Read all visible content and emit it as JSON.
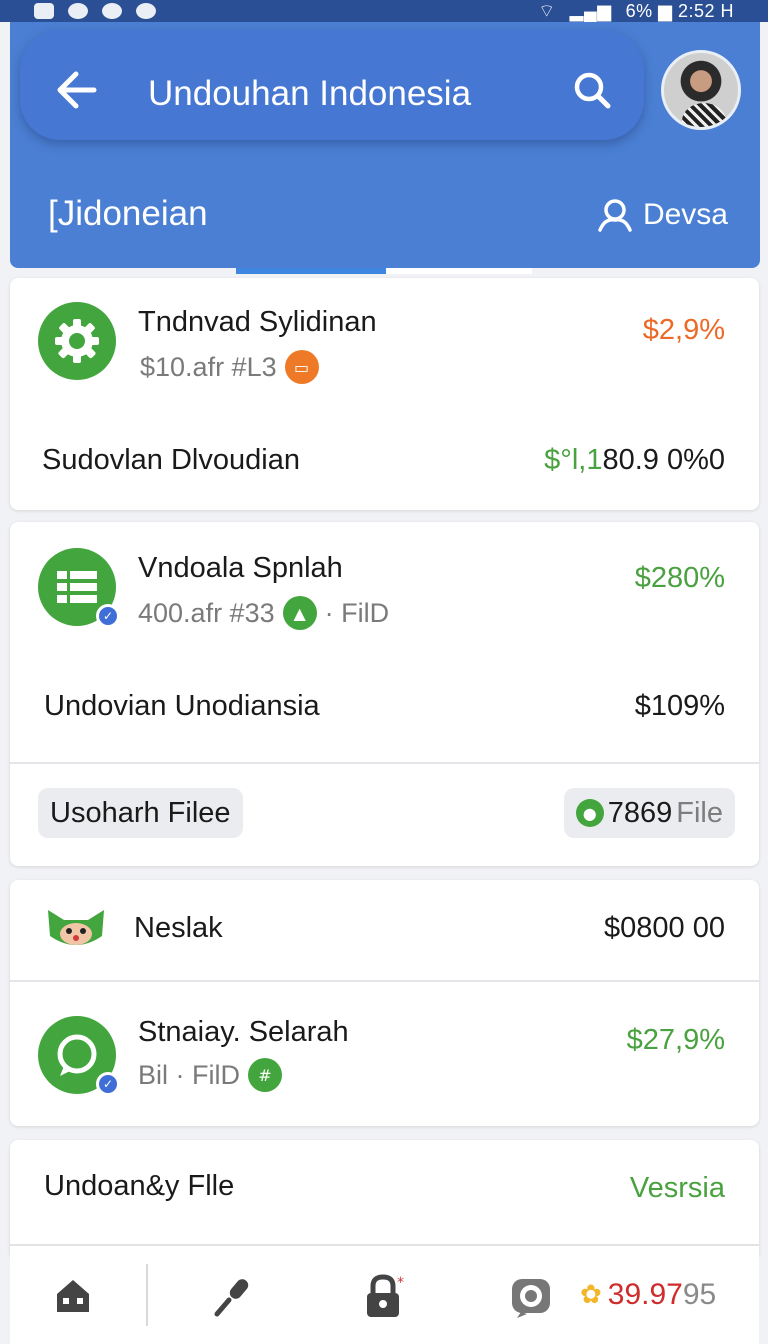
{
  "status_bar": {
    "right_text": "6% ▆ 2:52 H"
  },
  "header": {
    "title": "Undouhan Indonesia",
    "subtitle_left": "[Jidoneian",
    "subtitle_right": "Devsa"
  },
  "cards": {
    "c1": {
      "title": "Tndnvad Sylidinan",
      "subtitle": "$10.afr #L3",
      "value": "$2,9%",
      "row_label": "Sudovlan Dlvoudian",
      "row_value_a": "$°l,1",
      "row_value_b": "80.9 0%0"
    },
    "c2": {
      "title": "Vndoala Spnlah",
      "subtitle": "400.afr #33",
      "subtitle_tail": "· FilD",
      "value": "$280%",
      "row_label": "Undovian Unodiansia",
      "row_value": "$109%",
      "chip_left": "Usoharh Filee",
      "chip_right_num": "7869",
      "chip_right_tail": "File"
    },
    "c3": {
      "row1_title": "Neslak",
      "row1_value": "$0800 00",
      "title": "Stnaiay. Selarah",
      "subtitle": "Bil · FilD",
      "value": "$27,9%"
    },
    "c4": {
      "title": "Undoan&y Flle",
      "value": "Vesrsia"
    }
  },
  "bottom_nav": {
    "score_main": "39.97",
    "score_tail": "95"
  },
  "colors": {
    "header_blue": "#4b7fd3",
    "accent_green": "#43a53d",
    "accent_orange": "#ec6a28",
    "accent_red": "#cf2c2c"
  },
  "icons": [
    "back-arrow-icon",
    "search-icon",
    "person-icon",
    "gear-icon",
    "spreadsheet-icon",
    "chat-bubble-icon",
    "home-icon",
    "microphone-icon",
    "lock-icon",
    "camera-icon"
  ]
}
